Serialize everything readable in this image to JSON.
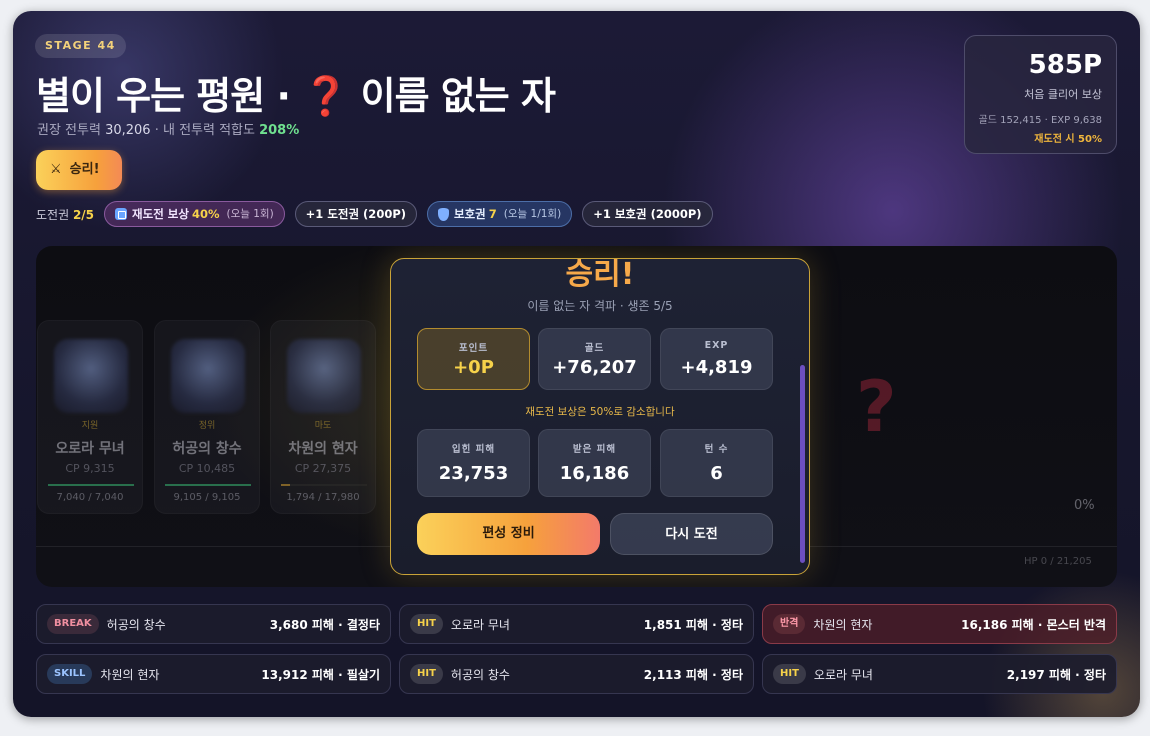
{
  "header": {
    "stage": "STAGE 44",
    "title_main": "별이 우는 평원 · ",
    "title_mark": "❓",
    "title_boss": " 이름 없는 자",
    "sub_prefix": "권장 전투력 ",
    "sub_power": "30,206",
    "sub_mid": " · 내 전투력 적합도 ",
    "sub_pct": "208%",
    "win_label": "승리!",
    "win_icon": "⚔"
  },
  "chips": {
    "tickets_label": "도전권 ",
    "tickets_value": "2/5",
    "retry_label": "재도전 보상",
    "retry_value": "40%",
    "retry_sub": "(오늘 1회)",
    "buy_ticket": "+1 도전권 (200P)",
    "shield_label": "보호권",
    "shield_value": "7",
    "shield_sub": "(오늘 1/1회)",
    "buy_shield": "+1 보호권 (2000P)"
  },
  "reward": {
    "points": "585P",
    "first_clear": "처음 클리어 보상",
    "detail": "골드 152,415 · EXP 9,638",
    "retry_note": "재도전 시 50%"
  },
  "units": [
    {
      "role": "지원",
      "name": "오로라 무녀",
      "cp": "CP 9,315",
      "hp": "7,040 / 7,040",
      "hp_frac": 1.0
    },
    {
      "role": "정위",
      "name": "허공의 창수",
      "cp": "CP 10,485",
      "hp": "9,105 / 9,105",
      "hp_frac": 1.0
    },
    {
      "role": "마도",
      "name": "차원의 현자",
      "cp": "CP 27,375",
      "hp": "1,794 / 17,980",
      "hp_frac": 0.1
    }
  ],
  "boss": {
    "pct": "0%",
    "hp": "HP 0 / 21,205"
  },
  "result": {
    "title": "승리!",
    "subtitle": "이름 없는 자 격파 · 생존 5/5",
    "stats_top": [
      {
        "label": "포인트",
        "value": "+0P"
      },
      {
        "label": "골드",
        "value": "+76,207"
      },
      {
        "label": "EXP",
        "value": "+4,819"
      }
    ],
    "note": "재도전 보상은 50%로 감소합니다",
    "stats_bottom": [
      {
        "label": "입힌 피해",
        "value": "23,753"
      },
      {
        "label": "받은 피해",
        "value": "16,186"
      },
      {
        "label": "턴 수",
        "value": "6"
      }
    ],
    "btn_primary": "편성 정비",
    "btn_secondary": "다시 도전"
  },
  "log": [
    {
      "tag": "BREAK",
      "who": "허공의 창수",
      "dmg": "3,680 피해 · 결정타"
    },
    {
      "tag": "HIT",
      "who": "오로라 무녀",
      "dmg": "1,851 피해 · 정타"
    },
    {
      "tag": "반격",
      "who": "차원의 현자",
      "dmg": "16,186 피해 · 몬스터 반격"
    },
    {
      "tag": "SKILL",
      "who": "차원의 현자",
      "dmg": "13,912 피해 · 필살기"
    },
    {
      "tag": "HIT",
      "who": "허공의 창수",
      "dmg": "2,113 피해 · 정타"
    },
    {
      "tag": "HIT",
      "who": "오로라 무녀",
      "dmg": "2,197 피해 · 정타"
    }
  ]
}
